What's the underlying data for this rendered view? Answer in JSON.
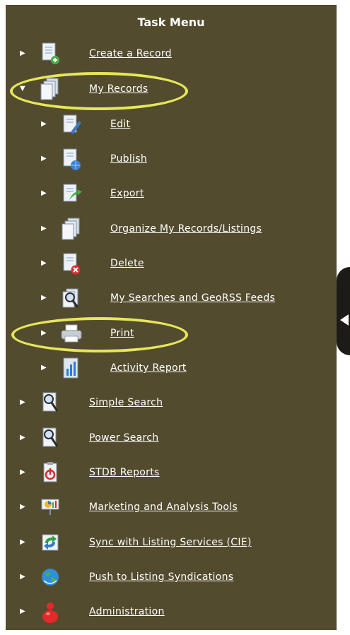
{
  "menu": {
    "title": "Task Menu",
    "items": [
      {
        "label": "Create a Record",
        "icon": "create-record-icon"
      },
      {
        "label": "My Records",
        "icon": "my-records-icon",
        "expanded": true
      },
      {
        "label": "Edit",
        "icon": "edit-icon"
      },
      {
        "label": "Publish",
        "icon": "publish-icon"
      },
      {
        "label": "Export",
        "icon": "export-icon"
      },
      {
        "label": "Organize My Records/Listings",
        "icon": "organize-icon"
      },
      {
        "label": "Delete",
        "icon": "delete-icon"
      },
      {
        "label": "My Searches and GeoRSS Feeds",
        "icon": "searches-feeds-icon"
      },
      {
        "label": "Print",
        "icon": "printer-icon"
      },
      {
        "label": "Activity Report",
        "icon": "activity-report-icon"
      },
      {
        "label": "Simple Search",
        "icon": "simple-search-icon"
      },
      {
        "label": "Power Search",
        "icon": "power-search-icon"
      },
      {
        "label": "STDB Reports",
        "icon": "stdb-reports-icon"
      },
      {
        "label": "Marketing and Analysis Tools",
        "icon": "marketing-tools-icon"
      },
      {
        "label": "Sync with Listing Services (CIE)",
        "icon": "sync-icon"
      },
      {
        "label": "Push to Listing Syndications",
        "icon": "globe-icon"
      },
      {
        "label": "Administration",
        "icon": "administration-icon"
      }
    ]
  },
  "colors": {
    "panel": "#534b2e",
    "highlight_ring": "#e6e65a",
    "text": "#ffffff"
  }
}
